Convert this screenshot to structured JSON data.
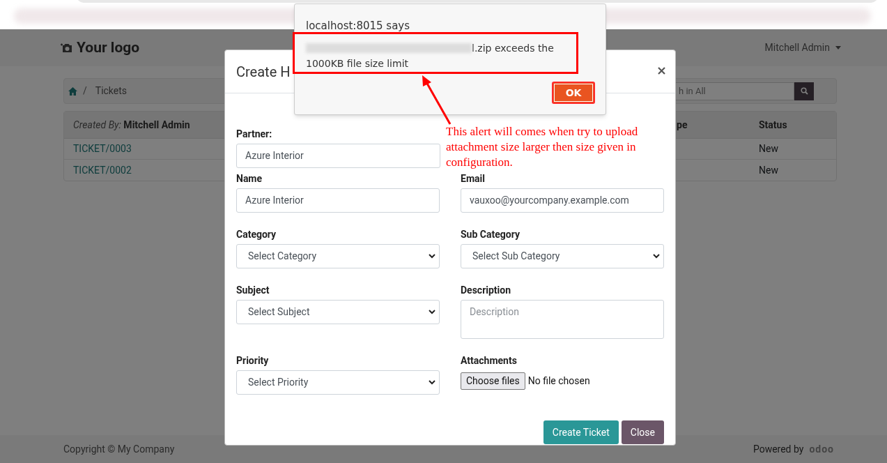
{
  "header": {
    "logo": "Your logo",
    "user_menu": "Mitchell Admin"
  },
  "breadcrumb": {
    "separator": "/",
    "current": "Tickets"
  },
  "search": {
    "placeholder": "h in All"
  },
  "table": {
    "columns": [
      "*Created By:* Mitchell Admin",
      "pe",
      "Status"
    ],
    "rows": [
      {
        "ticket": "TICKET/0003",
        "status": "New"
      },
      {
        "ticket": "TICKET/0002",
        "status": "New"
      }
    ]
  },
  "modal": {
    "title": "Create H",
    "fields": [
      {
        "label": "Partner:",
        "kind": "text",
        "value": "Azure Interior"
      },
      {
        "label": "Name",
        "kind": "text",
        "value": "Azure Interior"
      },
      {
        "label": "Email",
        "kind": "text",
        "value": "vauxoo@yourcompany.example.com"
      },
      {
        "label": "Category",
        "kind": "select",
        "value": "Select Category"
      },
      {
        "label": "Sub Category",
        "kind": "select",
        "value": "Select Sub Category"
      },
      {
        "label": "Subject",
        "kind": "select",
        "value": "Select Subject"
      },
      {
        "label": "Description",
        "kind": "textarea",
        "placeholder": "Description"
      },
      {
        "label": "Priority",
        "kind": "select",
        "value": "Select Priority"
      },
      {
        "label": "Attachments",
        "kind": "file",
        "button": "Choose files",
        "status": "No file chosen"
      }
    ],
    "buttons": [
      {
        "label": "Create Ticket",
        "kind": "primary"
      },
      {
        "label": "Close",
        "kind": "secondary"
      }
    ]
  },
  "alert": {
    "origin": "localhost:8015 says",
    "message_lines": [
      "l.zip exceeds the",
      "1000KB file size limit"
    ],
    "button": "OK"
  },
  "annotation": {
    "text": "This alert will comes when try to upload attachment size larger then size given in configuration."
  },
  "footer": {
    "copyright": "Copyright © My Company",
    "powered_by": "Powered by",
    "brand": "odoo"
  }
}
